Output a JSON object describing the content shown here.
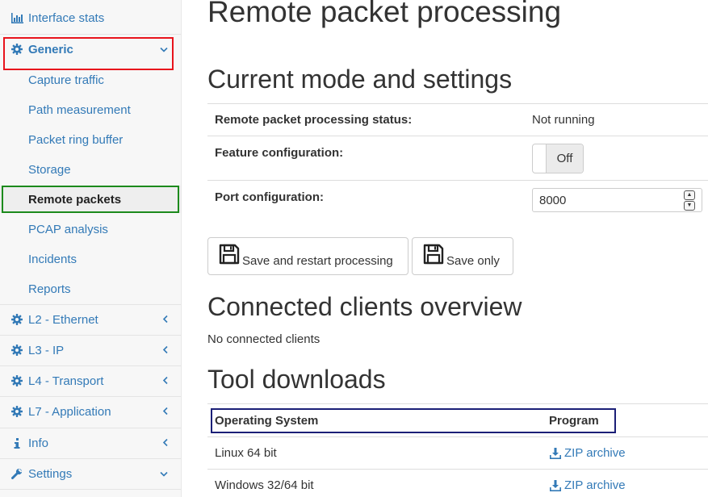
{
  "sidebar": {
    "items": [
      {
        "label": "Interface stats",
        "icon": "bar-chart-icon"
      },
      {
        "label": "Generic",
        "icon": "gear-icon",
        "expanded": true
      },
      {
        "label": "Capture traffic"
      },
      {
        "label": "Path measurement"
      },
      {
        "label": "Packet ring buffer"
      },
      {
        "label": "Storage"
      },
      {
        "label": "Remote packets",
        "active": true
      },
      {
        "label": "PCAP analysis"
      },
      {
        "label": "Incidents"
      },
      {
        "label": "Reports"
      },
      {
        "label": "L2 - Ethernet",
        "icon": "gear-icon"
      },
      {
        "label": "L3 - IP",
        "icon": "gear-icon"
      },
      {
        "label": "L4 - Transport",
        "icon": "gear-icon"
      },
      {
        "label": "L7 - Application",
        "icon": "gear-icon"
      },
      {
        "label": "Info",
        "icon": "info-icon"
      },
      {
        "label": "Settings",
        "icon": "wrench-icon",
        "expanded": true
      }
    ]
  },
  "main": {
    "title": "Remote packet processing",
    "mode_heading": "Current mode and settings",
    "settings": {
      "status_label": "Remote packet processing status:",
      "status_value": "Not running",
      "feature_label": "Feature configuration:",
      "feature_toggle": "Off",
      "port_label": "Port configuration:",
      "port_value": "8000"
    },
    "buttons": {
      "save_restart": "Save and restart processing",
      "save_only": "Save only"
    },
    "clients_heading": "Connected clients overview",
    "clients_text": "No connected clients",
    "downloads_heading": "Tool downloads",
    "downloads": {
      "columns": [
        "Operating System",
        "Program"
      ],
      "rows": [
        {
          "os": "Linux 64 bit",
          "program": "ZIP archive"
        },
        {
          "os": "Windows 32/64 bit",
          "program": "ZIP archive"
        }
      ]
    }
  },
  "colors": {
    "link": "#337ab7",
    "highlight_red": "#e8141c",
    "highlight_green": "#1c8a1c",
    "highlight_navy": "#1b1f77"
  }
}
